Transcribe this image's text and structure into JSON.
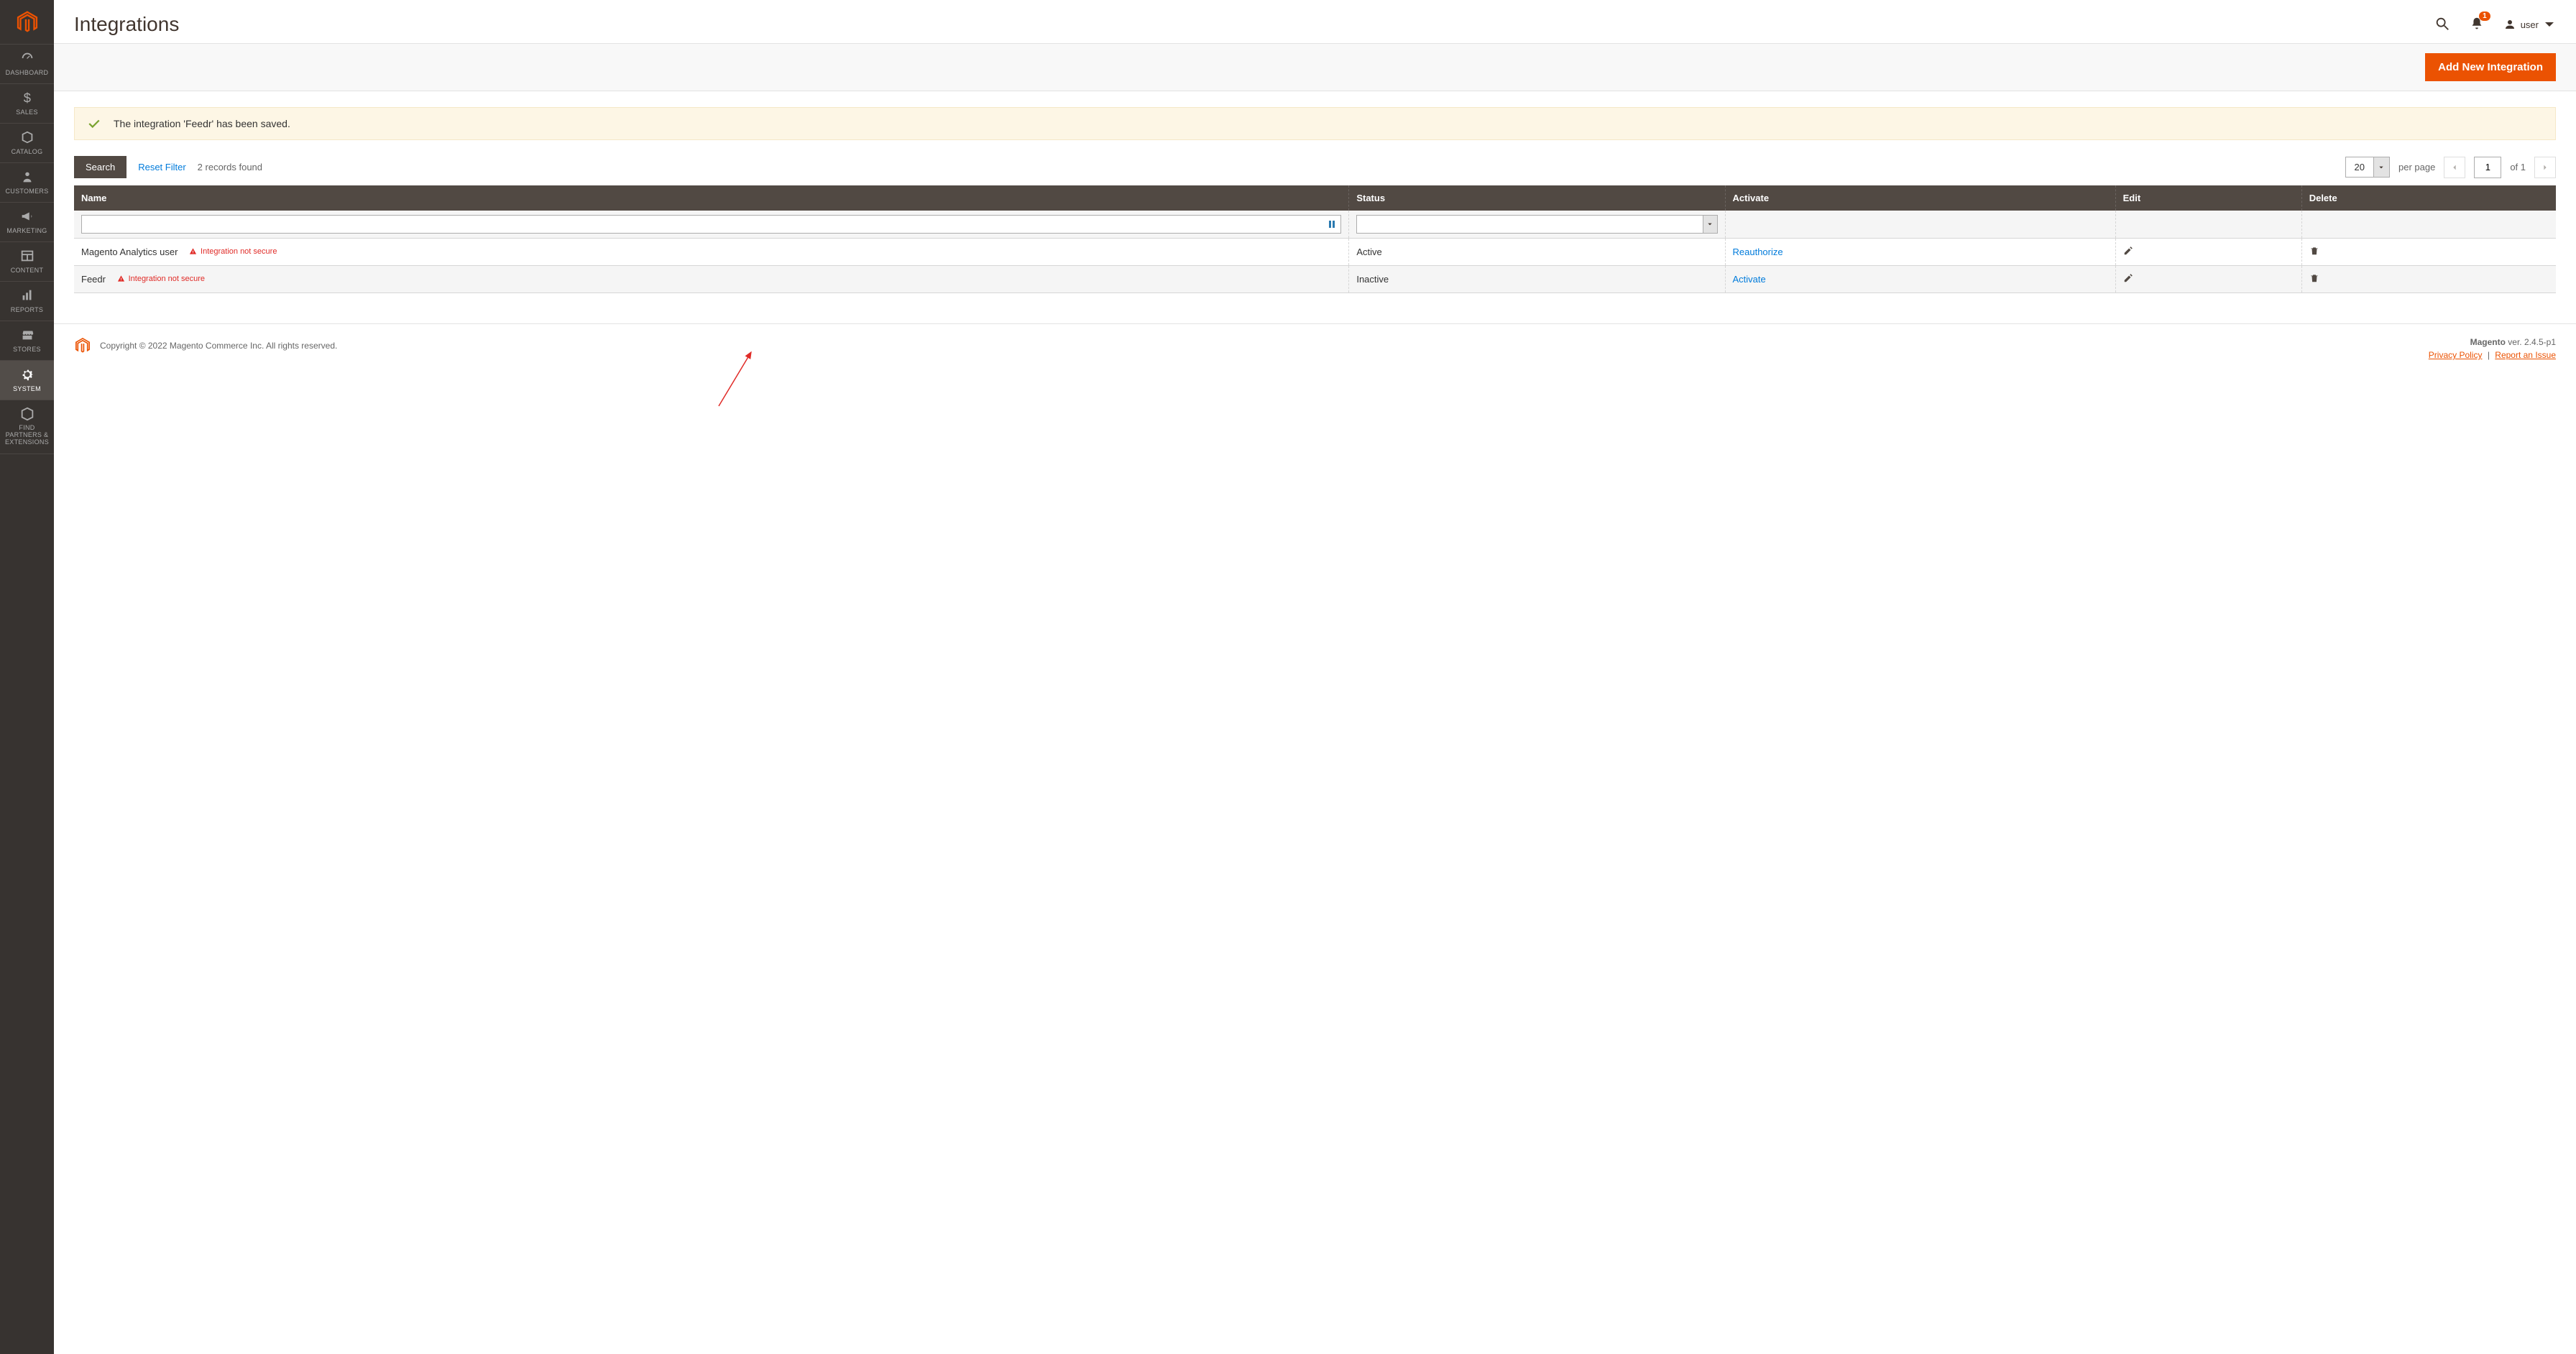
{
  "sidebar": {
    "items": [
      {
        "key": "dashboard",
        "label": "DASHBOARD"
      },
      {
        "key": "sales",
        "label": "SALES"
      },
      {
        "key": "catalog",
        "label": "CATALOG"
      },
      {
        "key": "customers",
        "label": "CUSTOMERS"
      },
      {
        "key": "marketing",
        "label": "MARKETING"
      },
      {
        "key": "content",
        "label": "CONTENT"
      },
      {
        "key": "reports",
        "label": "REPORTS"
      },
      {
        "key": "stores",
        "label": "STORES"
      },
      {
        "key": "system",
        "label": "SYSTEM"
      },
      {
        "key": "find-partners",
        "label": "FIND PARTNERS & EXTENSIONS"
      }
    ]
  },
  "header": {
    "title": "Integrations",
    "notification_count": "1",
    "username": "user"
  },
  "toolbar": {
    "add_button": "Add New Integration"
  },
  "message": {
    "text": "The integration 'Feedr' has been saved."
  },
  "controls": {
    "search_label": "Search",
    "reset_filter_label": "Reset Filter",
    "records_text": "2 records found",
    "per_page_value": "20",
    "per_page_label": "per page",
    "page_current": "1",
    "page_of": "of 1"
  },
  "grid": {
    "columns": {
      "name": "Name",
      "status": "Status",
      "activate": "Activate",
      "edit": "Edit",
      "delete": "Delete"
    },
    "warn_text": "Integration not secure",
    "rows": [
      {
        "name": "Magento Analytics user",
        "status": "Active",
        "activate_action": "Reauthorize"
      },
      {
        "name": "Feedr",
        "status": "Inactive",
        "activate_action": "Activate"
      }
    ]
  },
  "footer": {
    "copyright": "Copyright © 2022 Magento Commerce Inc. All rights reserved.",
    "magento_ver_prefix": "Magento",
    "magento_ver": "ver. 2.4.5-p1",
    "privacy": "Privacy Policy",
    "report": "Report an Issue"
  }
}
